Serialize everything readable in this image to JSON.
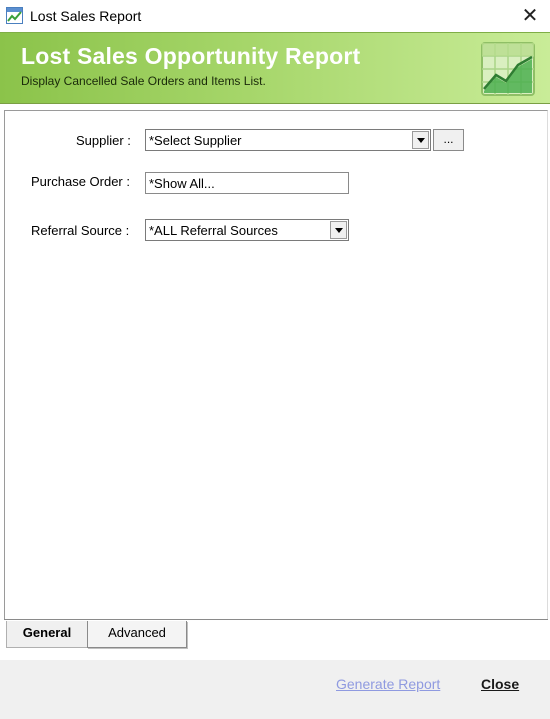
{
  "window": {
    "title": "Lost Sales Report",
    "close_glyph": "✕"
  },
  "banner": {
    "title": "Lost Sales Opportunity Report",
    "subtitle": "Display Cancelled Sale Orders and Items List."
  },
  "form": {
    "supplier": {
      "label": "Supplier :",
      "value": "*Select Supplier",
      "browse_label": "..."
    },
    "purchase_order": {
      "label": "Purchase Order :",
      "value": "*Show All..."
    },
    "referral_source": {
      "label": "Referral Source :",
      "value": "*ALL Referral Sources"
    }
  },
  "tabs": [
    {
      "label": "General",
      "active": true
    },
    {
      "label": "Advanced",
      "active": false
    }
  ],
  "footer": {
    "generate_label": "Generate Report",
    "close_label": "Close"
  },
  "colors": {
    "banner_green": "#8bc34a",
    "link_disabled": "#8f9ae0"
  },
  "icons": {
    "app": "chart-report-icon",
    "banner": "spreadsheet-chart-icon"
  }
}
